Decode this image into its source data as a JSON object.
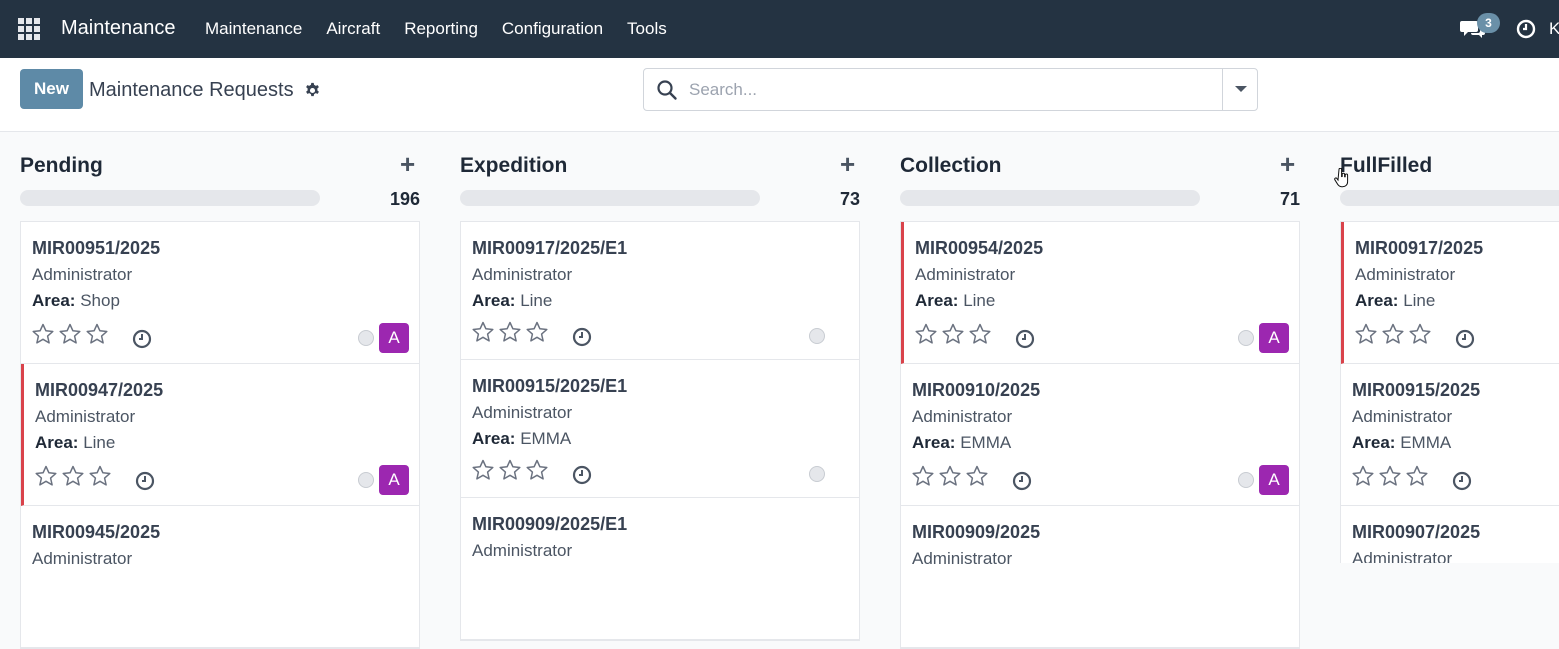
{
  "navbar": {
    "brand": "Maintenance",
    "menu": [
      "Maintenance",
      "Aircraft",
      "Reporting",
      "Configuration",
      "Tools"
    ],
    "chat_count": "3",
    "user_initial": "K"
  },
  "control": {
    "new_label": "New",
    "title": "Maintenance Requests",
    "search_placeholder": "Search..."
  },
  "columns": [
    {
      "title": "Pending",
      "count": "196",
      "cards": [
        {
          "ref": "MIR00951/2025",
          "user": "Administrator",
          "area_label": "Area:",
          "area": "Shop",
          "avatar": "A"
        },
        {
          "ref": "MIR00947/2025",
          "user": "Administrator",
          "area_label": "Area:",
          "area": "Line",
          "avatar": "A"
        },
        {
          "ref": "MIR00945/2025",
          "user": "Administrator"
        }
      ]
    },
    {
      "title": "Expedition",
      "count": "73",
      "cards": [
        {
          "ref": "MIR00917/2025/E1",
          "user": "Administrator",
          "area_label": "Area:",
          "area": "Line"
        },
        {
          "ref": "MIR00915/2025/E1",
          "user": "Administrator",
          "area_label": "Area:",
          "area": "EMMA"
        },
        {
          "ref": "MIR00909/2025/E1",
          "user": "Administrator"
        }
      ]
    },
    {
      "title": "Collection",
      "count": "71",
      "cards": [
        {
          "ref": "MIR00954/2025",
          "user": "Administrator",
          "area_label": "Area:",
          "area": "Line",
          "avatar": "A"
        },
        {
          "ref": "MIR00910/2025",
          "user": "Administrator",
          "area_label": "Area:",
          "area": "EMMA",
          "avatar": "A"
        },
        {
          "ref": "MIR00909/2025",
          "user": "Administrator"
        }
      ]
    },
    {
      "title": "FullFilled",
      "cards": [
        {
          "ref": "MIR00917/2025",
          "user": "Administrator",
          "area_label": "Area:",
          "area": "Line"
        },
        {
          "ref": "MIR00915/2025",
          "user": "Administrator",
          "area_label": "Area:",
          "area": "EMMA"
        },
        {
          "ref": "MIR00907/2025",
          "user": "Administrator"
        }
      ]
    }
  ],
  "icons": {
    "apps": "apps-grid-icon",
    "chat": "chat-icon",
    "activity": "clock-icon",
    "settings": "gear-icon",
    "search": "search-icon",
    "priority": "star-outline-icon",
    "add": "plus-icon"
  },
  "colors": {
    "navbar": "#243342",
    "primary": "#5e8aa7",
    "blocked_stripe": "#d9434b",
    "avatar": "#9c27b0"
  }
}
